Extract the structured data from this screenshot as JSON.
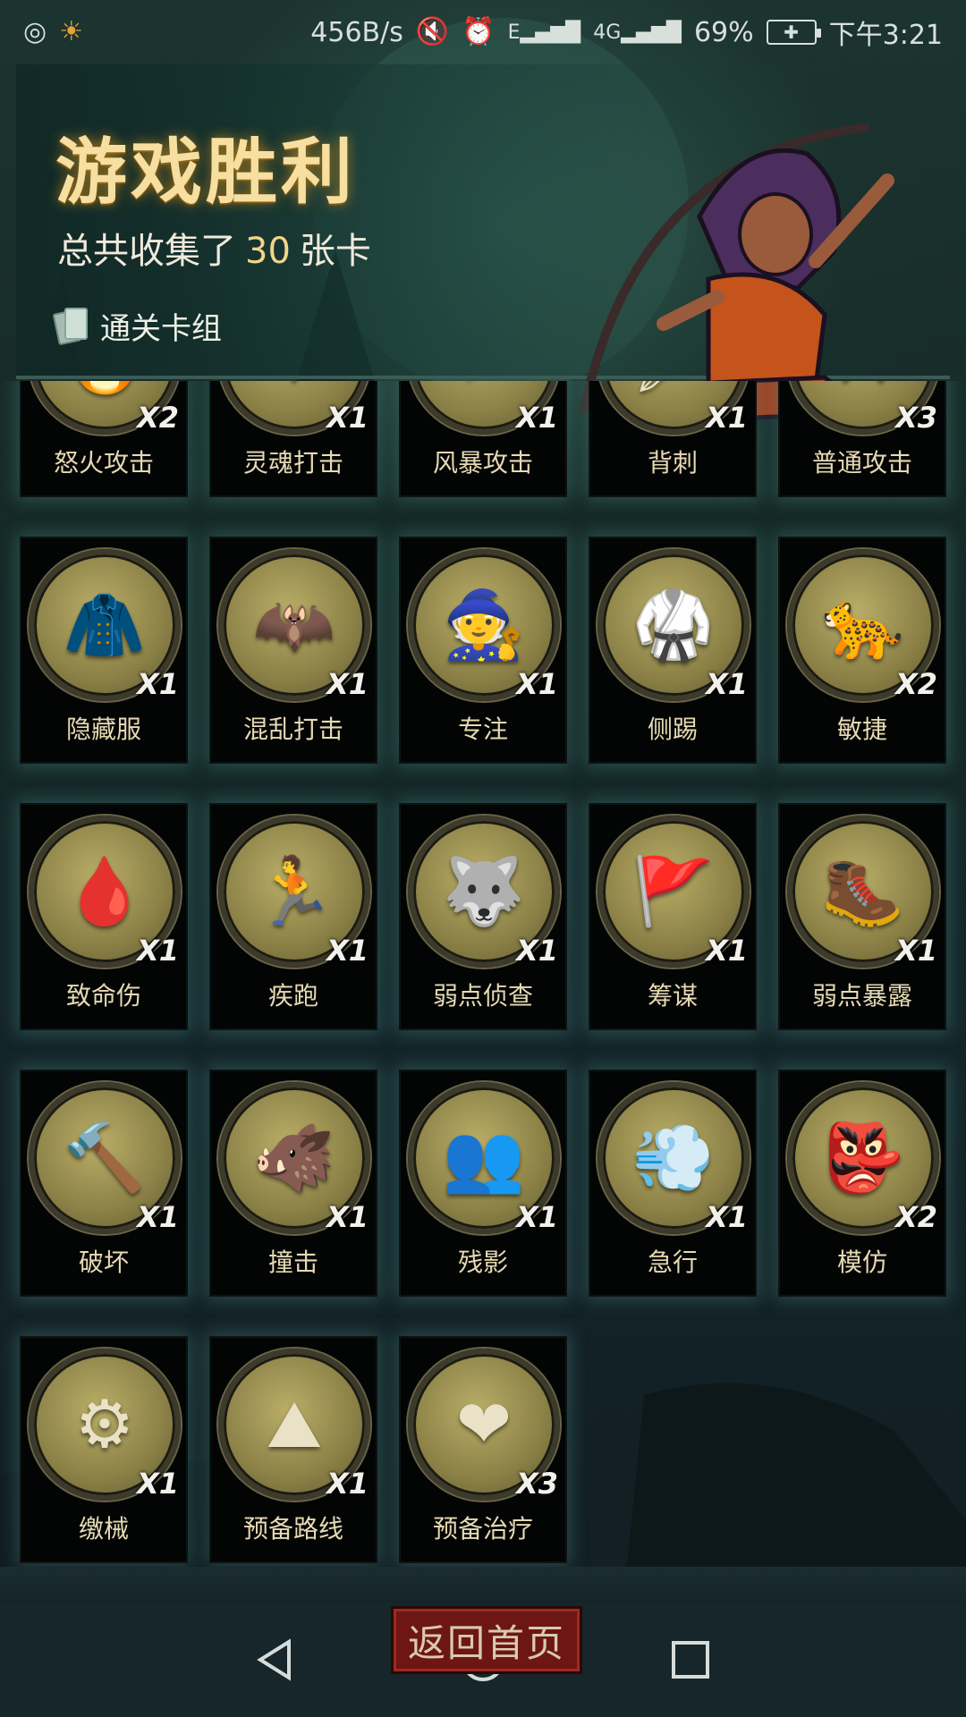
{
  "status_bar": {
    "network_speed": "456B/s",
    "battery": "69%",
    "time": "下午3:21",
    "signal_1": "E",
    "signal_2": "4G"
  },
  "banner": {
    "title": "游戏胜利",
    "subtitle_prefix": "总共收集了",
    "card_count": "30",
    "subtitle_suffix": "张卡",
    "deck_label": "通关卡组"
  },
  "cards": [
    {
      "name": "怒火攻击",
      "qty": "X2",
      "icon": "flame-icon",
      "glyph": "🔥"
    },
    {
      "name": "灵魂打击",
      "qty": "X1",
      "icon": "ice-shard-icon",
      "glyph": "❄"
    },
    {
      "name": "风暴攻击",
      "qty": "X1",
      "icon": "lightning-icon",
      "glyph": "⚡"
    },
    {
      "name": "背刺",
      "qty": "X1",
      "icon": "backstab-icon",
      "glyph": "🗡"
    },
    {
      "name": "普通攻击",
      "qty": "X3",
      "icon": "slash-icon",
      "glyph": "⚔"
    },
    {
      "name": "隐藏服",
      "qty": "X1",
      "icon": "hood-icon",
      "glyph": "🧥"
    },
    {
      "name": "混乱打击",
      "qty": "X1",
      "icon": "purple-claw-icon",
      "glyph": "🦇"
    },
    {
      "name": "专注",
      "qty": "X1",
      "icon": "wizard-icon",
      "glyph": "🧙"
    },
    {
      "name": "侧踢",
      "qty": "X1",
      "icon": "kick-icon",
      "glyph": "🥋"
    },
    {
      "name": "敏捷",
      "qty": "X2",
      "icon": "panther-icon",
      "glyph": "🐆"
    },
    {
      "name": "致命伤",
      "qty": "X1",
      "icon": "bloody-dagger-icon",
      "glyph": "🩸"
    },
    {
      "name": "疾跑",
      "qty": "X1",
      "icon": "running-beast-icon",
      "glyph": "🏃"
    },
    {
      "name": "弱点侦查",
      "qty": "X1",
      "icon": "wolf-icon",
      "glyph": "🐺"
    },
    {
      "name": "筹谋",
      "qty": "X1",
      "icon": "map-flags-icon",
      "glyph": "🚩"
    },
    {
      "name": "弱点暴露",
      "qty": "X1",
      "icon": "stabbed-boot-icon",
      "glyph": "🥾"
    },
    {
      "name": "破坏",
      "qty": "X1",
      "icon": "broken-sword-icon",
      "glyph": "🔨"
    },
    {
      "name": "撞击",
      "qty": "X1",
      "icon": "boar-icon",
      "glyph": "🐗"
    },
    {
      "name": "残影",
      "qty": "X1",
      "icon": "shadow-clones-icon",
      "glyph": "👥"
    },
    {
      "name": "急行",
      "qty": "X1",
      "icon": "dashing-warrior-icon",
      "glyph": "💨"
    },
    {
      "name": "模仿",
      "qty": "X2",
      "icon": "goblin-face-icon",
      "glyph": "👺"
    },
    {
      "name": "缴械",
      "qty": "X1",
      "icon": "gear-card-icon",
      "glyph": "⚙"
    },
    {
      "name": "预备路线",
      "qty": "X1",
      "icon": "mountain-map-icon",
      "glyph": "⛰"
    },
    {
      "name": "预备治疗",
      "qty": "X3",
      "icon": "heart-cross-icon",
      "glyph": "❤"
    }
  ],
  "footer": {
    "home_button": "返回首页"
  }
}
